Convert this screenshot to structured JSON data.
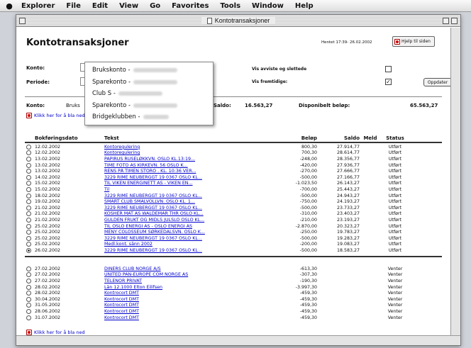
{
  "menubar": {
    "items": [
      "Explorer",
      "File",
      "Edit",
      "View",
      "Go",
      "Favorites",
      "Tools",
      "Window",
      "Help"
    ]
  },
  "window": {
    "title": "Kontotransaksjoner"
  },
  "page": {
    "title": "Kontotransaksjoner",
    "timestamp": "Hentet 17:39- 26.02.2002",
    "help_label": "Hjelp til siden"
  },
  "form": {
    "konto_label": "Konto:",
    "periode_label": "Periode:",
    "show_label": "Vis avviste og slettede",
    "future_label": "Vis fremtidige:",
    "show_checked": false,
    "future_checked": true,
    "update_label": "Oppdater"
  },
  "dropdown": {
    "options": [
      "Brukskonto -",
      "Sparekonto -",
      "Club S -",
      "Sparekonto -",
      "Bridgeklubben -"
    ]
  },
  "summary": {
    "konto_label": "Konto:",
    "konto_value": "Bruks",
    "saldo_label": "Saldo:",
    "saldo_value": "16.563,27",
    "disp_label": "Disponibelt beløp:",
    "disp_value": "65.563,27"
  },
  "links": {
    "top": "Klikk her for å bla ned",
    "bottom": "Klikk her for å bla ned"
  },
  "table": {
    "headers": {
      "date": "Bokføringsdato",
      "text": "Tekst",
      "amount": "Beløp",
      "balance": "Saldo",
      "med": "Meld",
      "status": "Status"
    },
    "rows": [
      {
        "date": "12.02.2002",
        "text": "Kontoregulering",
        "amount": "800,30",
        "balance": "27.914,77",
        "status": "Utført",
        "sel": false
      },
      {
        "date": "12.02.2002",
        "text": "Kontoregulering",
        "amount": "700,30",
        "balance": "28.614,77",
        "status": "Utført",
        "sel": false
      },
      {
        "date": "13.02.2002",
        "text": "PAPIRUS RUSELØKKVN. OSLO KL.13:19...",
        "amount": "-248,00",
        "balance": "28.356,77",
        "status": "Utført",
        "sel": false
      },
      {
        "date": "13.02.2002",
        "text": "TIME FOTO AS KIRKEVN. 56 OSLO K...",
        "amount": "-420,00",
        "balance": "27.936,77",
        "status": "Utført",
        "sel": false
      },
      {
        "date": "13.02.2002",
        "text": "RENS PÅ TIMEN STORO . KL. 10:36 VER...",
        "amount": "-270,00",
        "balance": "27.666,77",
        "status": "Utført",
        "sel": false
      },
      {
        "date": "14.02.2002",
        "text": "3229 RIME NEUBERGGT 19 0367 OSLO KL...",
        "amount": "-500,00",
        "balance": "27.166,77",
        "status": "Utført",
        "sel": false
      },
      {
        "date": "15.02.2002",
        "text": "TIL VIKEN ENERGINETT AS - VIKEN EN...",
        "amount": "-1.023,50",
        "balance": "26.143,27",
        "status": "Utført",
        "sel": false
      },
      {
        "date": "15.02.2002",
        "text": "Til",
        "amount": "-700,00",
        "balance": "25.443,27",
        "status": "Utført",
        "sel": false
      },
      {
        "date": "18.02.2002",
        "text": "3229 RIME NEUBERGGT 19 0367 OSLO KL...",
        "amount": "-500,00",
        "balance": "24.943,27",
        "status": "Utført",
        "sel": false
      },
      {
        "date": "19.02.2002",
        "text": "SMART CLUB SMALVOLLVN. OSLO KL. 1...",
        "amount": "-750,00",
        "balance": "24.193,27",
        "status": "Utført",
        "sel": false
      },
      {
        "date": "21.02.2002",
        "text": "3229 RIME NEUBERGGT 19 0367 OSLO KL...",
        "amount": "-500,00",
        "balance": "23.733,27",
        "status": "Utført",
        "sel": false
      },
      {
        "date": "21.02.2002",
        "text": "KOSHER MAT AS WALDEMAR THR OSLO KL...",
        "amount": "-310,00",
        "balance": "23.403,27",
        "status": "Utført",
        "sel": false
      },
      {
        "date": "21.02.2002",
        "text": "GULDEN FRUKT OG MIDLS JULSLO OSLO KL...",
        "amount": "-210,00",
        "balance": "23.193,27",
        "status": "Utført",
        "sel": false
      },
      {
        "date": "25.02.2002",
        "text": "TIL OSLO ENERGI AS - OSLO ENERGI AS",
        "amount": "-2.870,00",
        "balance": "20.323,27",
        "status": "Utført",
        "sel": false
      },
      {
        "date": "25.02.2002",
        "text": "MENY COLOSSEUM SØRKEDALSVN. OSLO K...",
        "amount": "-250,00",
        "balance": "19.783,27",
        "status": "Utført",
        "sel": false
      },
      {
        "date": "25.02.2002",
        "text": "3229 RIME NEUBERGGT 19 0367 OSLO KL...",
        "amount": "-500,00",
        "balance": "19.283,27",
        "status": "Utført",
        "sel": false
      },
      {
        "date": "25.02.2002",
        "text": "Medl.kont. sånn 2002",
        "amount": "-200,00",
        "balance": "19.083,27",
        "status": "Utført",
        "sel": false
      },
      {
        "date": "26.02.2002",
        "text": "3229 RIME NEUBERGGT 19 0367 OSLO KL...",
        "amount": "-500,00",
        "balance": "18.583,27",
        "status": "Utført",
        "sel": true
      }
    ],
    "future_rows": [
      {
        "date": "27.02.2002",
        "text": "DINERS CLUB NORGE A/S",
        "amount": "-613,30",
        "balance": "",
        "status": "Venter"
      },
      {
        "date": "27.02.2002",
        "text": "UNITED PAN-EUROPE COM NORGE AS",
        "amount": "-307,30",
        "balance": "",
        "status": "Venter"
      },
      {
        "date": "27.02.2002",
        "text": "TELENOR PRIVAT",
        "amount": "-190,30",
        "balance": "",
        "status": "Venter"
      },
      {
        "date": "28.02.2002",
        "text": "Lån 12.1000 Elton Eilifsen",
        "amount": "-3.997,30",
        "balance": "",
        "status": "Venter"
      },
      {
        "date": "28.02.2002",
        "text": "Kontrocort DMT",
        "amount": "-459,30",
        "balance": "",
        "status": "Venter"
      },
      {
        "date": "30.04.2002",
        "text": "Kontrocort DMT",
        "amount": "-459,30",
        "balance": "",
        "status": "Venter"
      },
      {
        "date": "31.05.2002",
        "text": "Kontrocort DMT",
        "amount": "-459,30",
        "balance": "",
        "status": "Venter"
      },
      {
        "date": "28.06.2002",
        "text": "Kontrocort DMT",
        "amount": "-459,30",
        "balance": "",
        "status": "Venter"
      },
      {
        "date": "31.07.2002",
        "text": "Kontrocort DMT",
        "amount": "-459,30",
        "balance": "",
        "status": "Venter"
      }
    ]
  }
}
